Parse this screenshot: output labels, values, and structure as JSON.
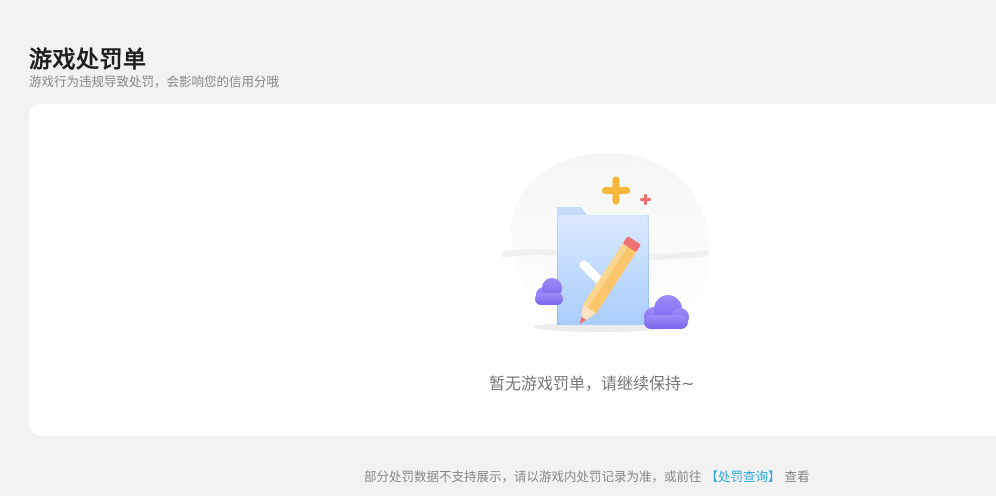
{
  "header": {
    "title": "游戏处罚单",
    "subtitle": "游戏行为违规导致处罚，会影响您的信用分哦"
  },
  "empty_state": {
    "illustration_icon": "document-check-pencil-icon",
    "message": "暂无游戏罚单，请继续保持~"
  },
  "footer": {
    "note": "部分处罚数据不支持展示，请以游戏内处罚记录为准，或前往",
    "link_label": "【处罚查询】",
    "suffix": "查看"
  },
  "colors": {
    "background": "#f2f2f2",
    "card": "#ffffff",
    "link": "#2ea7e0",
    "sparkle_orange": "#f5b63a",
    "sparkle_red": "#f26b6b",
    "cloud_purple": "#8f7bf2"
  }
}
